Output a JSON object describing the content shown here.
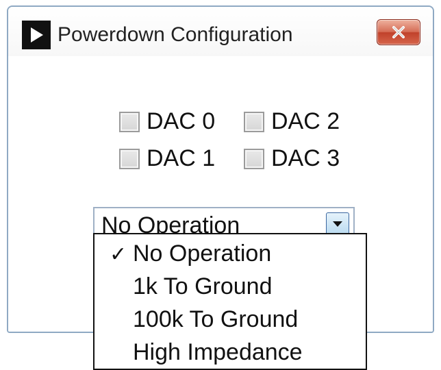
{
  "window": {
    "title": "Powerdown Configuration",
    "close_label": ""
  },
  "checkboxes": [
    {
      "label": "DAC 0",
      "checked": false
    },
    {
      "label": "DAC 2",
      "checked": false
    },
    {
      "label": "DAC 1",
      "checked": false
    },
    {
      "label": "DAC 3",
      "checked": false
    }
  ],
  "combo": {
    "selected": "No Operation",
    "options": [
      "No Operation",
      "1k To Ground",
      "100k To Ground",
      "High Impedance"
    ],
    "checked_index": 0
  },
  "icons": {
    "app": "play-triangle-icon",
    "close": "close-x-icon",
    "dropdown": "chevron-down-icon",
    "check": "checkmark-icon"
  }
}
